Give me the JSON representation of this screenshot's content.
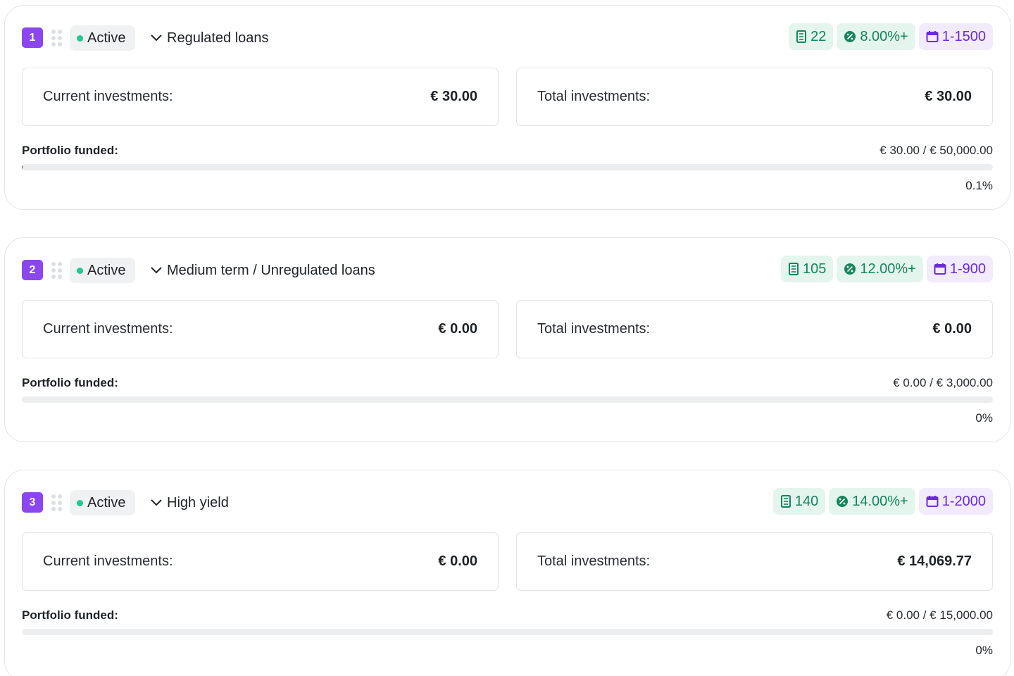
{
  "colors": {
    "accent_purple": "#8b46f0",
    "status_green": "#20c98a",
    "tag_green_bg": "#e4f5ee",
    "tag_green_text": "#15855a",
    "tag_purple_bg": "#f1ebfd",
    "tag_purple_text": "#6c2bd9"
  },
  "portfolios": [
    {
      "index": "1",
      "status": "Active",
      "title": "Regulated loans",
      "tags": {
        "loans_count": "22",
        "interest": "8.00%+",
        "term": "1-1500"
      },
      "current_label": "Current investments:",
      "current_amount": "€ 30.00",
      "total_label": "Total investments:",
      "total_amount": "€ 30.00",
      "funded_label": "Portfolio funded:",
      "funded_ratio": "€ 30.00 / € 50,000.00",
      "funded_percent_text": "0.1%",
      "funded_fraction": 0.001
    },
    {
      "index": "2",
      "status": "Active",
      "title": "Medium term / Unregulated loans",
      "tags": {
        "loans_count": "105",
        "interest": "12.00%+",
        "term": "1-900"
      },
      "current_label": "Current investments:",
      "current_amount": "€ 0.00",
      "total_label": "Total investments:",
      "total_amount": "€ 0.00",
      "funded_label": "Portfolio funded:",
      "funded_ratio": "€ 0.00 / € 3,000.00",
      "funded_percent_text": "0%",
      "funded_fraction": 0
    },
    {
      "index": "3",
      "status": "Active",
      "title": "High yield",
      "tags": {
        "loans_count": "140",
        "interest": "14.00%+",
        "term": "1-2000"
      },
      "current_label": "Current investments:",
      "current_amount": "€ 0.00",
      "total_label": "Total investments:",
      "total_amount": "€ 14,069.77",
      "funded_label": "Portfolio funded:",
      "funded_ratio": "€ 0.00 / € 15,000.00",
      "funded_percent_text": "0%",
      "funded_fraction": 0
    }
  ],
  "icons": {
    "drag": "drag-handle-icon",
    "chevron": "chevron-down-icon",
    "loans": "document-list-icon",
    "interest": "percent-badge-icon",
    "term": "calendar-icon"
  }
}
